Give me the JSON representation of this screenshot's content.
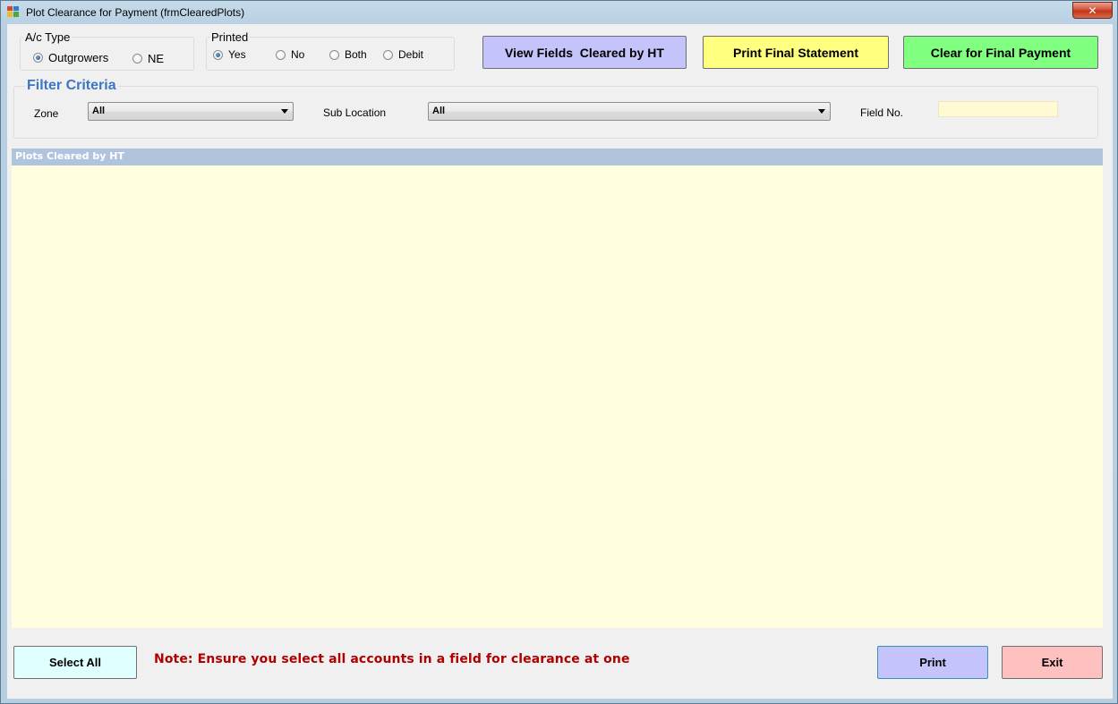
{
  "window": {
    "title": "Plot Clearance for Payment (frmClearedPlots)",
    "close_symbol": "✕"
  },
  "ac_type": {
    "legend": "A/c Type",
    "options": [
      {
        "label": "Outgrowers",
        "selected": true
      },
      {
        "label": "NE",
        "selected": false
      }
    ]
  },
  "printed": {
    "legend": "Printed",
    "options": [
      {
        "label": "Yes",
        "selected": true
      },
      {
        "label": "No",
        "selected": false
      },
      {
        "label": "Both",
        "selected": false
      },
      {
        "label": "Debit",
        "selected": false
      }
    ]
  },
  "actions": {
    "view_fields": "View Fields  Cleared by HT",
    "print_final": "Print Final Statement",
    "clear_final": "Clear for Final Payment"
  },
  "filter": {
    "title": "Filter Criteria",
    "zone_label": "Zone",
    "zone_value": "All",
    "sublocation_label": "Sub Location",
    "sublocation_value": "All",
    "field_no_label": "Field No.",
    "field_no_value": ""
  },
  "grid": {
    "header": "Plots Cleared by HT"
  },
  "footer": {
    "select_all": "Select All",
    "note": "Note: Ensure you select all accounts in a field for clearance at one",
    "print": "Print",
    "exit": "Exit"
  },
  "colors": {
    "view_fields_bg": "#c4c4fb",
    "print_final_bg": "#ffff80",
    "clear_final_bg": "#80ff80",
    "select_all_bg": "#e0ffff",
    "print_bg": "#c4c4fb",
    "exit_bg": "#ffc0c0",
    "grid_header_bg": "#b0c4de",
    "grid_body_bg": "#ffffe0",
    "note_color": "#b00000",
    "filter_title_color": "#3d76c4"
  }
}
